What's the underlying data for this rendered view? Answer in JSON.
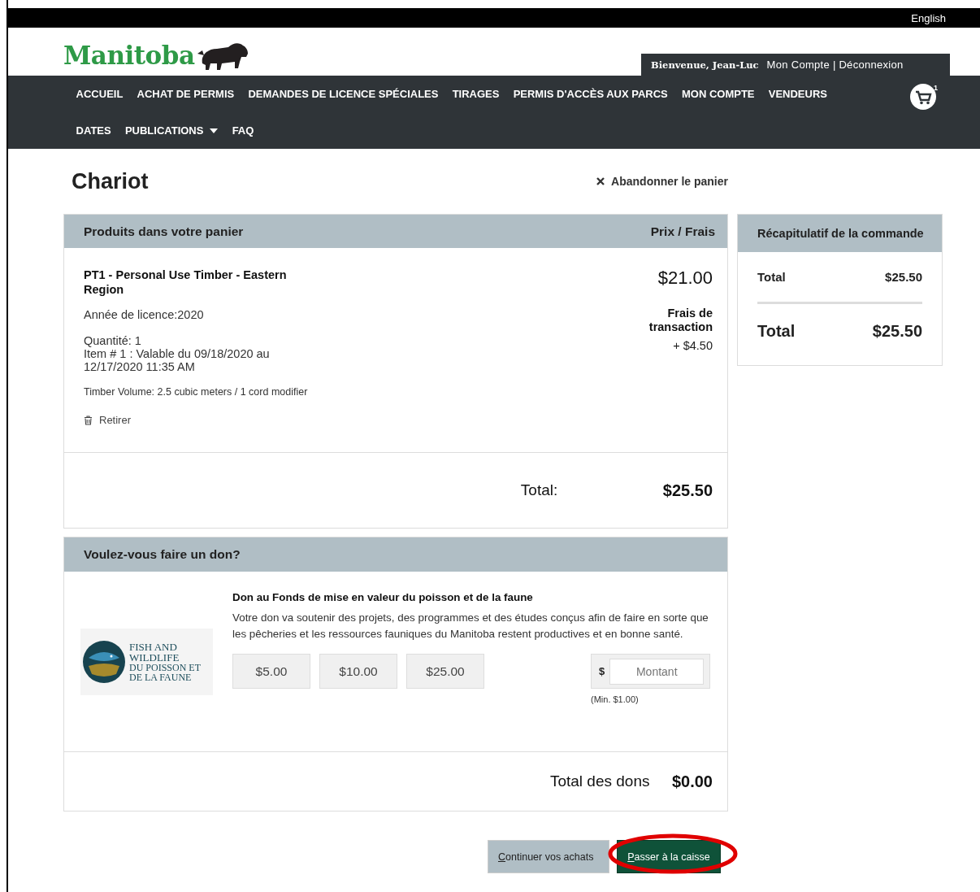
{
  "top_bar": {
    "language_link": "English"
  },
  "header": {
    "logo_text": "Manitoba",
    "welcome": "Bienvenue, Jean-Luc",
    "account_link": "Mon Compte",
    "separator": "|",
    "logout_link": "Déconnexion"
  },
  "nav": {
    "items": [
      {
        "label": "ACCUEIL",
        "kind": "link"
      },
      {
        "label": "ACHAT DE PERMIS",
        "kind": "link"
      },
      {
        "label": "DEMANDES DE LICENCE SPÉCIALES",
        "kind": "link"
      },
      {
        "label": "TIRAGES",
        "kind": "link"
      },
      {
        "label": "PERMIS D'ACCÈS AUX PARCS",
        "kind": "link"
      },
      {
        "label": "MON COMPTE",
        "kind": "link"
      },
      {
        "label": "VENDEURS",
        "kind": "link"
      },
      {
        "label": "DATES",
        "kind": "link"
      },
      {
        "label": "PUBLICATIONS",
        "kind": "dropdown"
      },
      {
        "label": "FAQ",
        "kind": "link"
      }
    ],
    "cart_count": "1"
  },
  "page": {
    "title": "Chariot",
    "abandon": "Abandonner le panier"
  },
  "cart": {
    "heading": "Produits dans votre panier",
    "price_heading": "Prix / Frais",
    "items": [
      {
        "name": "PT1 - Personal Use Timber - Eastern Region",
        "year": "Année de licence:2020",
        "quantity": "Quantité: 1",
        "validity": "Item # 1 : Valable du 09/18/2020 au 12/17/2020 11:35 AM",
        "volume": "Timber Volume: 2.5 cubic meters / 1 cord modifier",
        "remove": "Retirer",
        "price": "$21.00",
        "fee_label": "Frais de transaction",
        "fee": "+ $4.50"
      }
    ],
    "total_label": "Total:",
    "total": "$25.50"
  },
  "summary": {
    "heading": "Récapitulatif de la commande",
    "subtotal_label": "Total",
    "subtotal": "$25.50",
    "total_label": "Total",
    "total": "$25.50"
  },
  "donation": {
    "heading": "Voulez-vous faire un don?",
    "logo_lines": [
      "FISH AND",
      "WILDLIFE",
      "DU POISSON ET",
      "DE LA FAUNE"
    ],
    "title": "Don au Fonds de mise en valeur du poisson et de la faune",
    "description": "Votre don va soutenir des projets, des programmes et des études conçus afin de faire en sorte que les pêcheries et les ressources fauniques du Manitoba restent productives et en bonne santé.",
    "amounts": [
      {
        "label": "$5.00",
        "selected": false
      },
      {
        "label": "$10.00",
        "selected": false
      },
      {
        "label": "$25.00",
        "selected": false
      }
    ],
    "currency": "$",
    "amount_placeholder": "Montant",
    "minimum": "(Min. $1.00)",
    "total_label": "Total des dons",
    "total": "$0.00"
  },
  "buttons": [
    {
      "label": "Continuer vos achats",
      "kind": "secondary"
    },
    {
      "label": "Passer à la caisse",
      "kind": "primary"
    }
  ],
  "annotation": {
    "kind": "ellipse",
    "color": "#e00000"
  }
}
